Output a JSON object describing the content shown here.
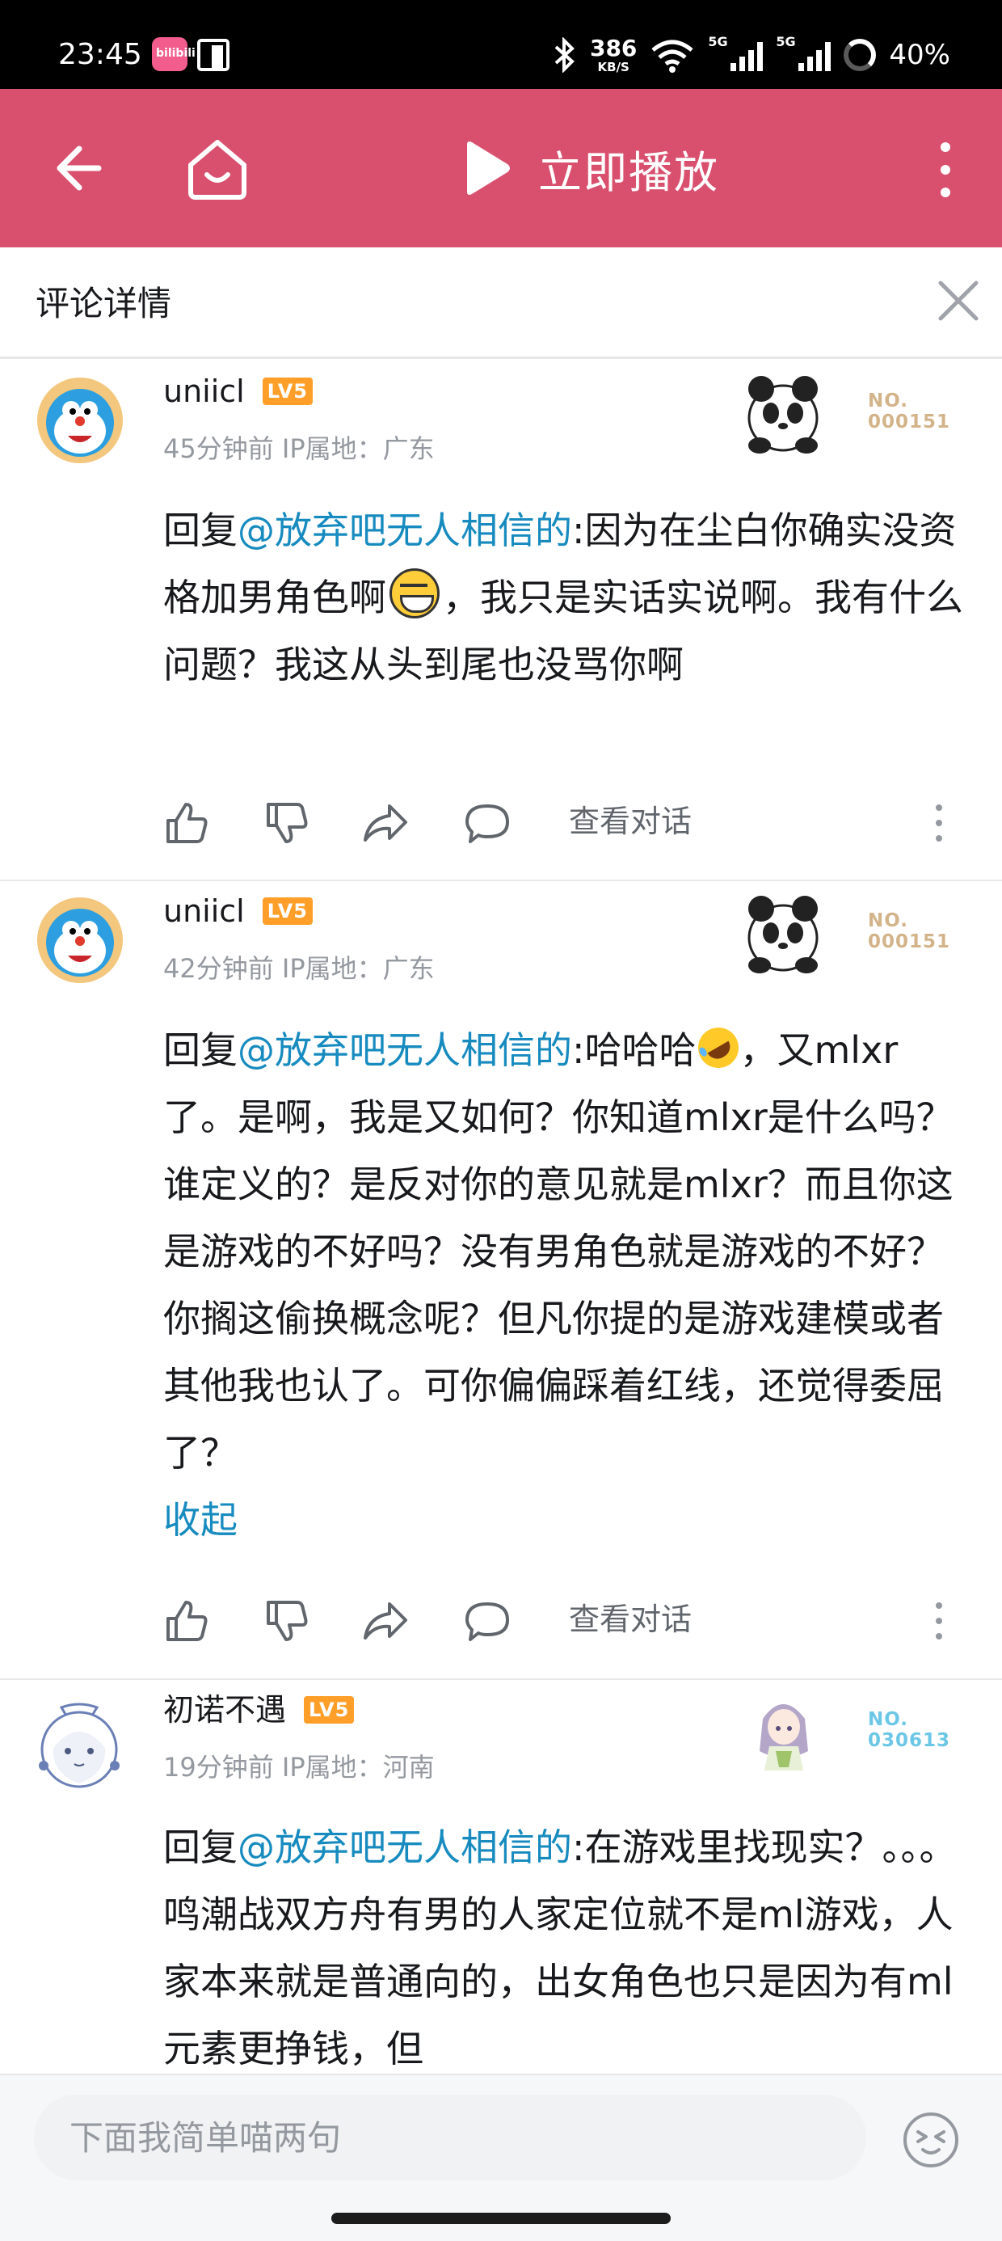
{
  "status_bar": {
    "time": "23:45",
    "app_icon_text": "bilibili",
    "net_speed_value": "386",
    "net_speed_unit": "KB/S",
    "signal_1_label": "5G",
    "signal_2_label": "5G",
    "battery": "40%"
  },
  "app_bar": {
    "back_icon": "back-arrow-icon",
    "home_icon": "home-icon",
    "play_icon": "play-icon",
    "play_label": "立即播放",
    "more_icon": "more-vertical-icon",
    "color": "#d9506f"
  },
  "sheet": {
    "title": "评论详情",
    "close_icon": "close-icon"
  },
  "comments": [
    {
      "username": "uniicl",
      "level": "LV5",
      "meta": "45分钟前 IP属地：广东",
      "fan_no_label": "NO.",
      "fan_no": "000151",
      "reply_prefix": "回复",
      "mention": "@放弃吧无人相信的",
      "text_1": ":因为在尘白你确实没资格加男角色啊",
      "text_2": "，我只是实话实说啊。我有什么问题？我这从头到尾也没骂你啊",
      "view_conversation": "查看对话"
    },
    {
      "username": "uniicl",
      "level": "LV5",
      "meta": "42分钟前 IP属地：广东",
      "fan_no_label": "NO.",
      "fan_no": "000151",
      "reply_prefix": "回复",
      "mention": "@放弃吧无人相信的",
      "text_1": ":哈哈哈",
      "text_2": "，又mlxr了。是啊，我是又如何？你知道mlxr是什么吗？谁定义的？是反对你的意见就是mlxr？而且你这是游戏的不好吗？没有男角色就是游戏的不好？你搁这偷换概念呢？但凡你提的是游戏建模或者其他我也认了。可你偏偏踩着红线，还觉得委屈了？",
      "collapse": "收起",
      "view_conversation": "查看对话"
    },
    {
      "username": "初诺不遇",
      "level": "LV5",
      "meta": "19分钟前 IP属地：河南",
      "fan_no_label": "NO.",
      "fan_no": "030613",
      "reply_prefix": "回复",
      "mention": "@放弃吧无人相信的",
      "text_1": ":在游戏里找现实？。。。鸣潮战双方舟有男的人家定位就不是ml游戏，人家本来就是普通向的，出女角色也只是因为有ml元素更挣钱，但"
    }
  ],
  "bottom_bar": {
    "input_placeholder": "下面我简单喵两句",
    "emoji_icon": "emoji-icon"
  },
  "colors": {
    "accent": "#d9506f",
    "mention": "#178bbf",
    "level_badge": "#ff9f2a",
    "meta_text": "#9499a0"
  }
}
